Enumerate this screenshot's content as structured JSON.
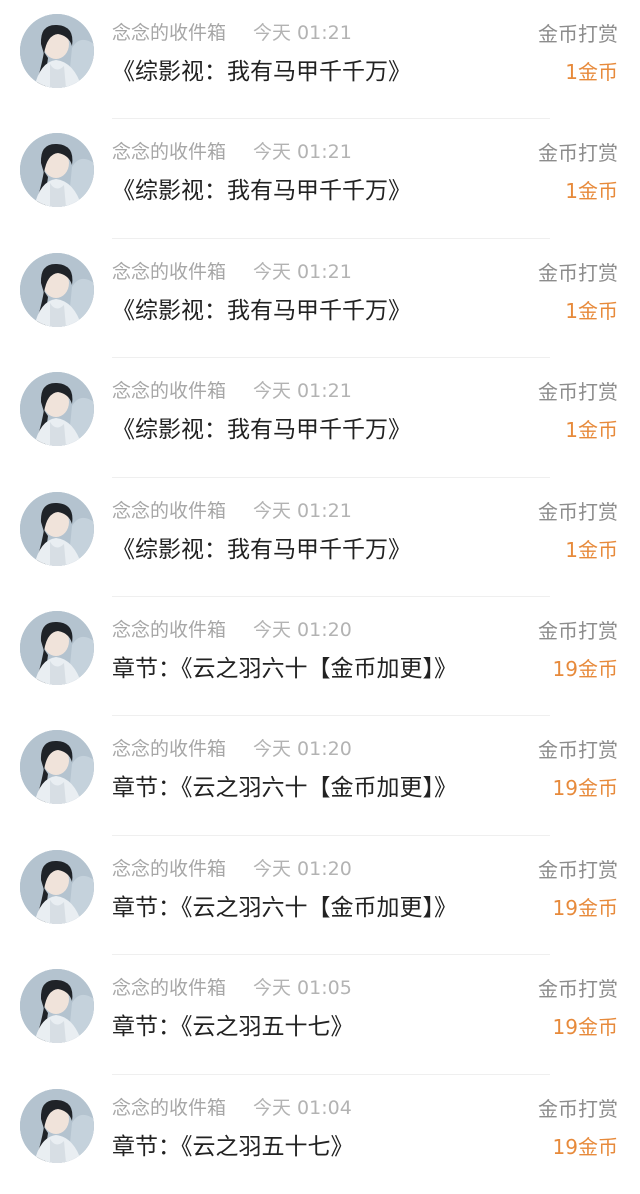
{
  "colors": {
    "sender": "#a6a6a6",
    "time": "#b3b3b3",
    "title": "#222222",
    "action": "#8c8c8c",
    "amount": "#e78a3b",
    "divider": "#efefef"
  },
  "items": [
    {
      "avatar": "user-avatar",
      "sender": "念念的收件箱",
      "time": "今天 01:21",
      "title": "《综影视：我有马甲千千万》",
      "action": "金币打赏",
      "amount": "1金币"
    },
    {
      "avatar": "user-avatar",
      "sender": "念念的收件箱",
      "time": "今天 01:21",
      "title": "《综影视：我有马甲千千万》",
      "action": "金币打赏",
      "amount": "1金币"
    },
    {
      "avatar": "user-avatar",
      "sender": "念念的收件箱",
      "time": "今天 01:21",
      "title": "《综影视：我有马甲千千万》",
      "action": "金币打赏",
      "amount": "1金币"
    },
    {
      "avatar": "user-avatar",
      "sender": "念念的收件箱",
      "time": "今天 01:21",
      "title": "《综影视：我有马甲千千万》",
      "action": "金币打赏",
      "amount": "1金币"
    },
    {
      "avatar": "user-avatar",
      "sender": "念念的收件箱",
      "time": "今天 01:21",
      "title": "《综影视：我有马甲千千万》",
      "action": "金币打赏",
      "amount": "1金币"
    },
    {
      "avatar": "user-avatar",
      "sender": "念念的收件箱",
      "time": "今天 01:20",
      "title": "章节：《云之羽六十【金币加更】》",
      "action": "金币打赏",
      "amount": "19金币"
    },
    {
      "avatar": "user-avatar",
      "sender": "念念的收件箱",
      "time": "今天 01:20",
      "title": "章节：《云之羽六十【金币加更】》",
      "action": "金币打赏",
      "amount": "19金币"
    },
    {
      "avatar": "user-avatar",
      "sender": "念念的收件箱",
      "time": "今天 01:20",
      "title": "章节：《云之羽六十【金币加更】》",
      "action": "金币打赏",
      "amount": "19金币"
    },
    {
      "avatar": "user-avatar",
      "sender": "念念的收件箱",
      "time": "今天 01:05",
      "title": "章节：《云之羽五十七》",
      "action": "金币打赏",
      "amount": "19金币"
    },
    {
      "avatar": "user-avatar",
      "sender": "念念的收件箱",
      "time": "今天 01:04",
      "title": "章节：《云之羽五十七》",
      "action": "金币打赏",
      "amount": "19金币"
    }
  ]
}
